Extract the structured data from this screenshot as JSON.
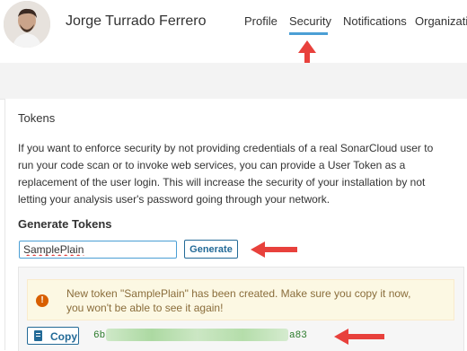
{
  "header": {
    "user_name": "Jorge Turrado Ferrero",
    "tabs": [
      {
        "label": "Profile",
        "active": false
      },
      {
        "label": "Security",
        "active": true
      },
      {
        "label": "Notifications",
        "active": false
      },
      {
        "label": "Organizations",
        "active": false
      }
    ]
  },
  "tokens": {
    "title": "Tokens",
    "description": "If you want to enforce security by not providing credentials of a real SonarCloud user to run your code scan or to invoke web services, you can provide a User Token as a replacement of the user login. This will increase the security of your installation by not letting your analysis user's password going through your network.",
    "generate_title": "Generate Tokens",
    "token_name_value": "SamplePlain",
    "generate_label": "Generate",
    "alert_text": "New token \"SamplePlain\" has been created. Make sure you copy it now, you won't be able to see it again!",
    "alert_icon_glyph": "!",
    "copy_label": "Copy",
    "token_value_start": "6b",
    "token_value_end": "a83"
  },
  "colors": {
    "accent": "#4b9fd5",
    "button": "#236a97",
    "annotation_arrow": "#e8413c",
    "warning_bg": "#fcf8e3",
    "warning_icon": "#d85f00",
    "token_text": "#2a7a2a"
  },
  "icons": [
    "user-avatar",
    "warning-icon",
    "clipboard-icon",
    "red-arrow-annotation"
  ]
}
